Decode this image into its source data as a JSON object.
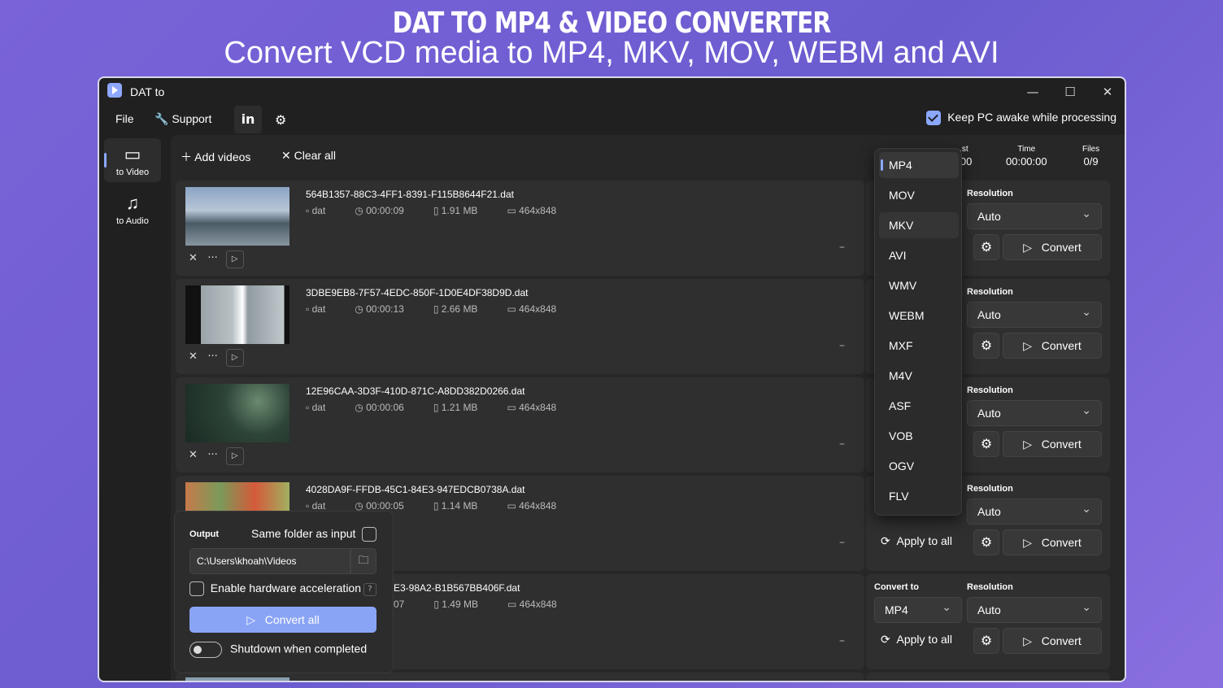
{
  "banner": {
    "title": "DAT TO MP4 & VIDEO CONVERTER",
    "subtitle": "Convert VCD media to MP4, MKV, MOV, WEBM and AVI"
  },
  "window": {
    "title": "DAT to",
    "minimize": "—",
    "maximize": "☐",
    "close": "✕"
  },
  "menu": {
    "file": "File",
    "support": "Support",
    "linkedin": "in",
    "keep_awake": "Keep PC awake while processing"
  },
  "sidebar": [
    {
      "label": "to Video",
      "icon": "video-camera-icon",
      "active": true
    },
    {
      "label": "to Audio",
      "icon": "music-note-icon",
      "active": false
    }
  ],
  "toolbar": {
    "add": "Add videos",
    "clear": "Clear all"
  },
  "stats": {
    "cost_label": "...st",
    "cost_value": "0:00",
    "time_label": "Time",
    "time_value": "00:00:00",
    "files_label": "Files",
    "files_value": "0/9"
  },
  "files": [
    {
      "name": "564B1357-88C3-4FF1-8391-F115B8644F21.dat",
      "ext": "dat",
      "duration": "00:00:09",
      "size": "1.91 MB",
      "res": "464x848"
    },
    {
      "name": "3DBE9EB8-7F57-4EDC-850F-1D0E4DF38D9D.dat",
      "ext": "dat",
      "duration": "00:00:13",
      "size": "2.66 MB",
      "res": "464x848"
    },
    {
      "name": "12E96CAA-3D3F-410D-871C-A8DD382D0266.dat",
      "ext": "dat",
      "duration": "00:00:06",
      "size": "1.21 MB",
      "res": "464x848"
    },
    {
      "name": "4028DA9F-FFDB-45C1-84E3-947EDCB0738A.dat",
      "ext": "dat",
      "duration": "00:00:05",
      "size": "1.14 MB",
      "res": "464x848"
    },
    {
      "name": "E3-98A2-B1B567BB406F.dat",
      "ext": "",
      "duration": "07",
      "size": "1.49 MB",
      "res": "464x848"
    }
  ],
  "row_panel": {
    "convert_to_label": "Convert to",
    "resolution_label": "Resolution",
    "resolution_value": "Auto",
    "format_value": "MP4",
    "apply_all": "Apply to all",
    "convert": "Convert"
  },
  "formats": [
    "MP4",
    "MOV",
    "MKV",
    "AVI",
    "WMV",
    "WEBM",
    "MXF",
    "M4V",
    "ASF",
    "VOB",
    "OGV",
    "FLV"
  ],
  "output": {
    "label": "Output",
    "same_folder": "Same folder as input",
    "path": "C:\\Users\\khoah\\Videos",
    "hw_accel": "Enable hardware acceleration",
    "help": "?",
    "convert_all": "Convert all",
    "shutdown": "Shutdown when completed"
  },
  "colors": {
    "accent": "#8aa8ff",
    "background": "#202020"
  }
}
